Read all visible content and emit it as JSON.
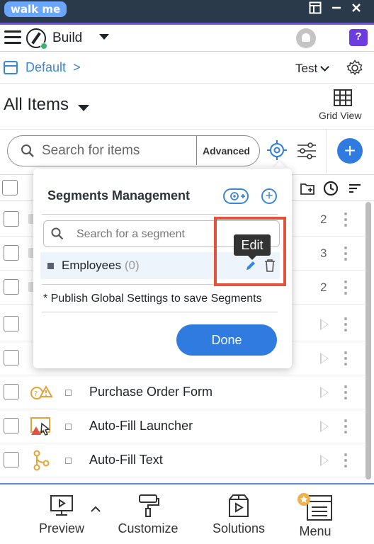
{
  "window": {
    "logo_text": "walk me"
  },
  "toolbar": {
    "build_label": "Build"
  },
  "context": {
    "default_label": "Default",
    "default_chevron": ">",
    "env_label": "Test"
  },
  "items": {
    "title": "All Items",
    "grid_view_label": "Grid View",
    "search_placeholder": "Search for items",
    "advanced_label": "Advanced"
  },
  "list": {
    "rows": [
      {
        "count": "2"
      },
      {
        "count": "3"
      },
      {
        "count": "2"
      },
      {
        "count": ""
      },
      {
        "count": ""
      },
      {
        "label": "Purchase Order Form"
      },
      {
        "label": "Auto-Fill Launcher"
      },
      {
        "label": "Auto-Fill Text"
      }
    ]
  },
  "segments_popup": {
    "title": "Segments Management",
    "search_placeholder": "Search for a segment",
    "segments": [
      {
        "name": "Employees",
        "count": "(0)"
      }
    ],
    "note": "* Publish Global Settings to save Segments",
    "done_label": "Done",
    "tooltip": "Edit"
  },
  "bottom_bar": {
    "preview_label": "Preview",
    "customize_label": "Customize",
    "solutions_label": "Solutions",
    "menu_label": "Menu"
  },
  "colors": {
    "accent_blue": "#2f7be0",
    "link_blue": "#3a86d8",
    "highlight_red": "#e0533c",
    "titlebar": "#2b3a4a",
    "help_purple": "#6d3be0"
  }
}
